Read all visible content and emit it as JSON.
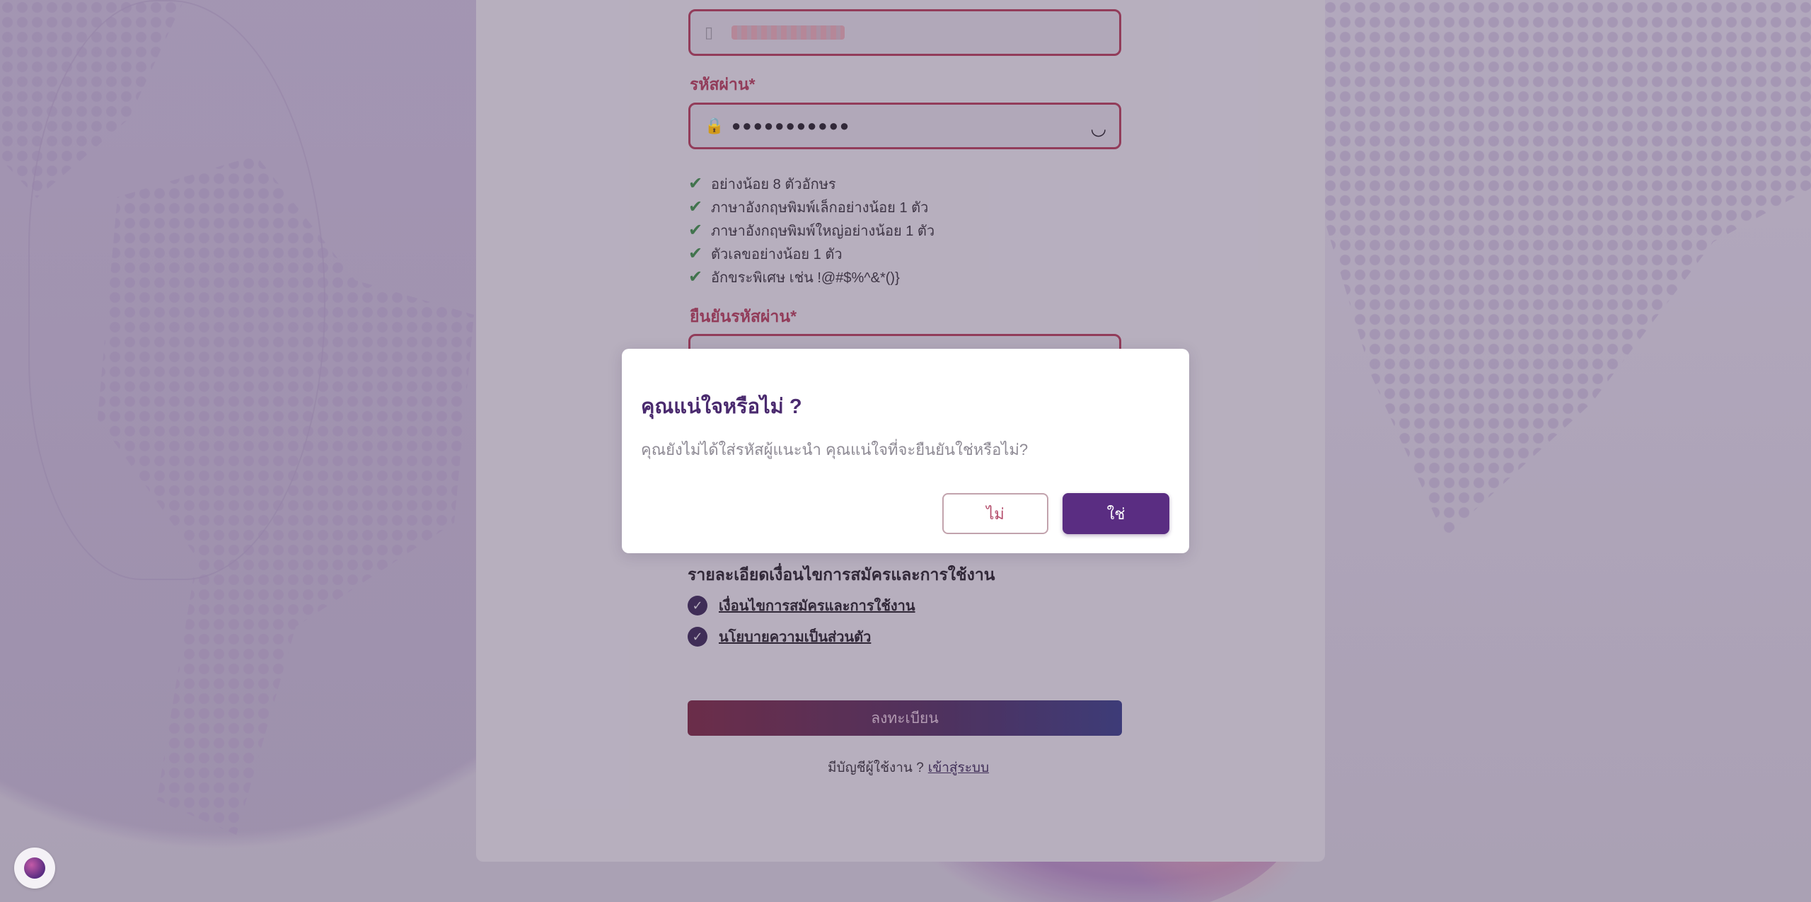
{
  "form": {
    "email_masked_value": "",
    "password_label": "รหัสผ่าน",
    "password_value": "●●●●●●●●●●●",
    "required_mark": "*",
    "rules": [
      "อย่างน้อย 8 ตัวอักษร",
      "ภาษาอังกฤษพิมพ์เล็กอย่างน้อย 1 ตัว",
      "ภาษาอังกฤษพิมพ์ใหญ่อย่างน้อย 1 ตัว",
      "ตัวเลขอย่างน้อย 1 ตัว",
      "อักขระพิเศษ เช่น !@#$%^&*()}"
    ],
    "confirm_label": "ยืนยันรหัสผ่าน",
    "terms_title": "รายละเอียดเงื่อนไขการสมัครและการใช้งาน",
    "terms": [
      "เงื่อนไขการสมัครและการใช้งาน",
      "นโยบายความเป็นส่วนตัว"
    ],
    "register_label": "ลงทะเบียน",
    "have_account": "มีบัญชีผู้ใช้งาน ?",
    "login_link": "เข้าสู่ระบบ"
  },
  "modal": {
    "title": "คุณแน่ใจหรือไม่ ?",
    "message": "คุณยังไม่ได้ใส่รหัสผู้แนะนำ คุณแน่ใจที่จะยืนยันใช่หรือไม่?",
    "no_label": "ไม่",
    "yes_label": "ใช่"
  },
  "colors": {
    "accent": "#5a2d82",
    "error_border": "#9a3b58",
    "check": "#3f7a4a"
  },
  "icons": {
    "email_field": "phone-icon",
    "password_field": "lock-icon",
    "toggle_visibility": "eye-closed-icon",
    "rule_check": "check-icon",
    "terms_check": "check-circle-icon",
    "chat_widget": "globe-icon"
  }
}
